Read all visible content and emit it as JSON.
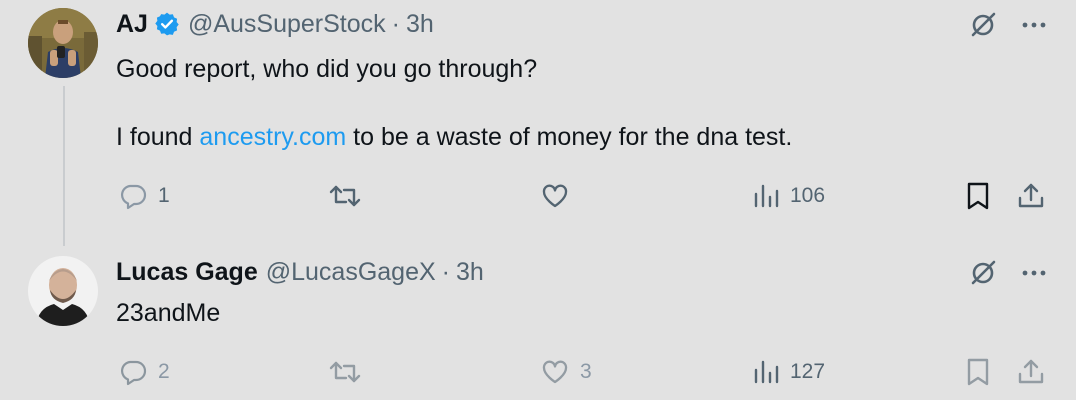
{
  "tweets": [
    {
      "display_name": "AJ",
      "verified": true,
      "handle": "@AusSuperStock",
      "separator": "·",
      "time": "3h",
      "text_line_1": "Good report, who did you go through?",
      "text_line_2_prefix": "I found ",
      "text_line_2_link": "ancestry.com",
      "text_line_2_suffix": " to be a waste of money for the dna test.",
      "reply_count": "1",
      "retweet_count": "",
      "like_count": "",
      "view_count": "106"
    },
    {
      "display_name": "Lucas Gage",
      "verified": false,
      "handle": "@LucasGageX",
      "separator": "·",
      "time": "3h",
      "text_line_1": "23andMe",
      "reply_count": "2",
      "retweet_count": "",
      "like_count": "3",
      "view_count": "127"
    }
  ],
  "colors": {
    "background": "#e2e2e2",
    "text": "#0f1419",
    "muted": "#536471",
    "link": "#1d9bf0",
    "verified": "#1d9bf0"
  },
  "icons": [
    "verified-badge-icon",
    "grok-icon",
    "more-icon",
    "reply-icon",
    "retweet-icon",
    "like-icon",
    "views-icon",
    "bookmark-icon",
    "share-icon"
  ]
}
